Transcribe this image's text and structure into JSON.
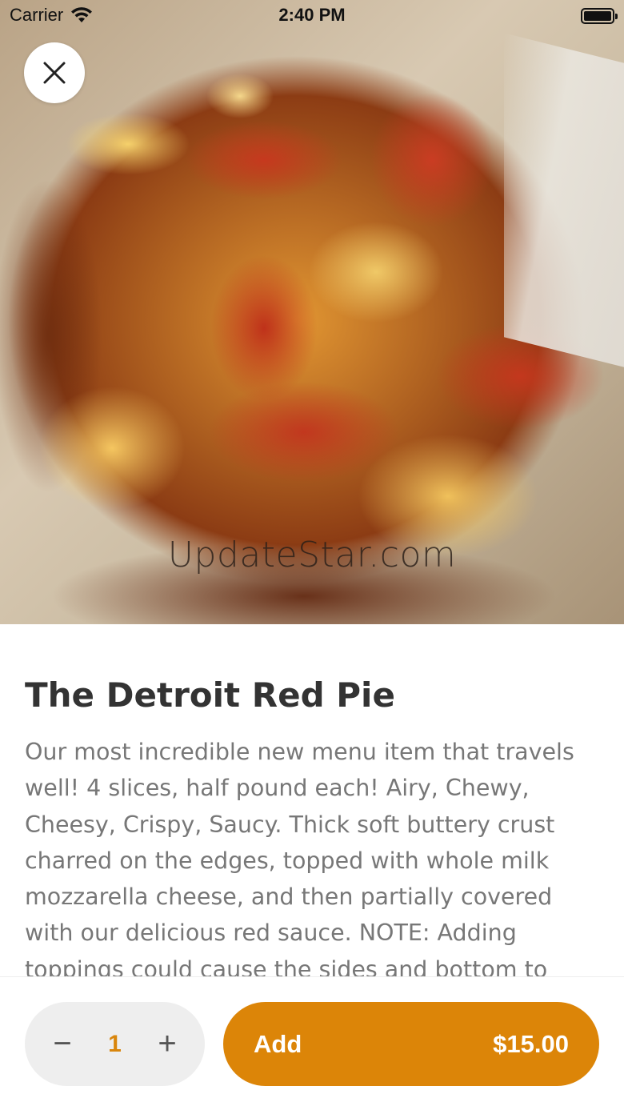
{
  "status_bar": {
    "carrier": "Carrier",
    "time": "2:40 PM",
    "icons": [
      "wifi-icon",
      "battery-icon"
    ]
  },
  "hero": {
    "watermark": "UpdateStar.com"
  },
  "close_button": {
    "icon": "close-icon"
  },
  "item": {
    "title": "The Detroit Red Pie",
    "description": "Our most incredible new menu item that travels well!  4 slices, half pound each! Airy, Chewy, Cheesy, Crispy, Saucy.  Thick soft buttery crust charred on the edges, topped with whole milk mozzarella cheese, and then partially covered with our delicious red sauce.  NOTE:  Adding toppings could cause the sides and bottom to char more."
  },
  "quantity": {
    "decrement_label": "−",
    "value": "1",
    "increment_label": "+"
  },
  "add_button": {
    "label": "Add",
    "price": "$15.00"
  },
  "colors": {
    "accent": "#dc8508",
    "quantity_text": "#d9860d",
    "title_text": "#333333",
    "body_text": "#777777",
    "stepper_bg": "#eeeeee"
  }
}
